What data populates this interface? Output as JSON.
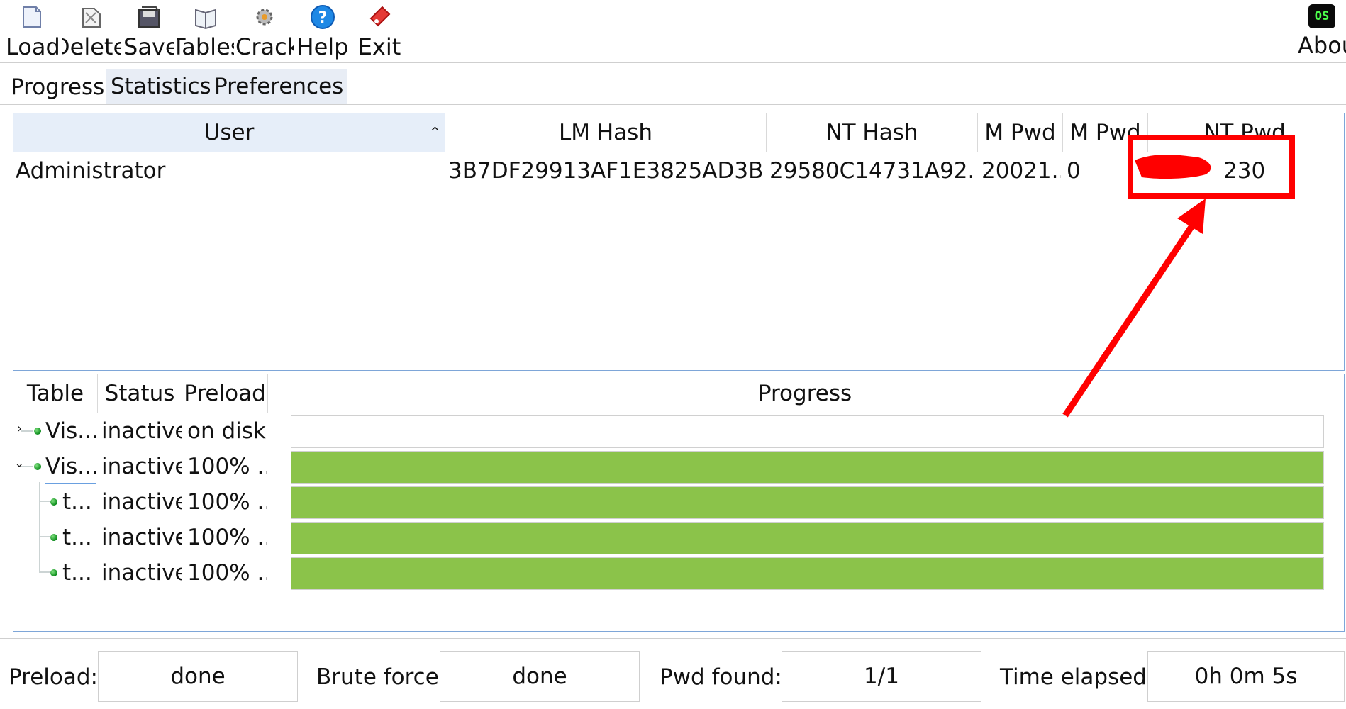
{
  "toolbar": {
    "buttons": [
      {
        "label": "Load",
        "icon": "load-icon"
      },
      {
        "label": "Delete",
        "icon": "delete-icon"
      },
      {
        "label": "Save",
        "icon": "save-icon"
      },
      {
        "label": "Tables",
        "icon": "tables-icon"
      },
      {
        "label": "Crack",
        "icon": "crack-icon"
      },
      {
        "label": "Help",
        "icon": "help-icon"
      },
      {
        "label": "Exit",
        "icon": "exit-icon"
      },
      {
        "label": "About",
        "icon": "about-icon"
      }
    ],
    "about_badge": "OS"
  },
  "tabs": [
    {
      "label": "Progress",
      "active": true
    },
    {
      "label": "Statistics",
      "active": false
    },
    {
      "label": "Preferences",
      "active": false
    }
  ],
  "users_table": {
    "columns": [
      "User",
      "LM Hash",
      "NT Hash",
      "M Pwd",
      "M Pwd",
      "NT Pwd"
    ],
    "rows": [
      {
        "user": "Administrator",
        "lm_hash": "3B7DF29913AF1E3825AD3B8...",
        "nt_hash": "29580C14731A92...",
        "lm_pwd": "20021...",
        "lm_pwd2": "0",
        "nt_pwd": "230"
      }
    ]
  },
  "progress_table": {
    "columns": [
      "Table",
      "Status",
      "Preload",
      "Progress"
    ],
    "rows": [
      {
        "table": "Vis...",
        "status": "inactive",
        "preload": "on disk",
        "progress": 0
      },
      {
        "table": "Vis...",
        "status": "inactive",
        "preload": "100% ...",
        "progress": 100
      },
      {
        "table": "t...",
        "status": "inactive",
        "preload": "100% ...",
        "progress": 100
      },
      {
        "table": "t...",
        "status": "inactive",
        "preload": "100% ...",
        "progress": 100
      },
      {
        "table": "t...",
        "status": "inactive",
        "preload": "100% ...",
        "progress": 100
      }
    ]
  },
  "statusbar": {
    "preload_label": "Preload:",
    "preload_value": "done",
    "brute_label": "Brute force:",
    "brute_value": "done",
    "found_label": "Pwd found:",
    "found_value": "1/1",
    "time_label": "Time elapsed:",
    "time_value": "0h 0m 5s"
  },
  "colors": {
    "progress_fill": "#8bc34a",
    "annotation": "#ff0000",
    "panel_border": "#7ea6d8",
    "header_active": "#e6eef9"
  }
}
